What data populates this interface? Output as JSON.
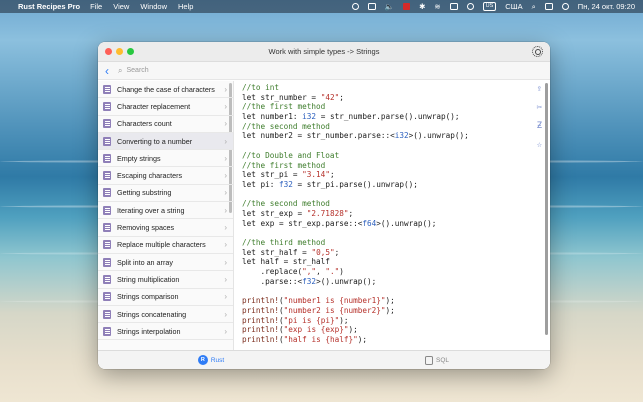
{
  "menubar": {
    "app_name": "Rust Recipes Pro",
    "menus": [
      "File",
      "View",
      "Window",
      "Help"
    ],
    "input_source": "США",
    "datetime": "Пн, 24 окт.  09:20"
  },
  "window": {
    "title": "Work with simple types -> Strings",
    "search_placeholder": "Search"
  },
  "sidebar": {
    "items": [
      {
        "label": "Change the case of characters",
        "active": false
      },
      {
        "label": "Character replacement",
        "active": false
      },
      {
        "label": "Characters count",
        "active": false
      },
      {
        "label": "Converting to a number",
        "active": true
      },
      {
        "label": "Empty strings",
        "active": false
      },
      {
        "label": "Escaping characters",
        "active": false
      },
      {
        "label": "Getting substring",
        "active": false
      },
      {
        "label": "Iterating over a string",
        "active": false
      },
      {
        "label": "Removing spaces",
        "active": false
      },
      {
        "label": "Replace multiple characters",
        "active": false
      },
      {
        "label": "Split into an array",
        "active": false
      },
      {
        "label": "String multiplication",
        "active": false
      },
      {
        "label": "Strings comparison",
        "active": false
      },
      {
        "label": "Strings concatenating",
        "active": false
      },
      {
        "label": "Strings interpolation",
        "active": false
      }
    ]
  },
  "code_lines": [
    "//to int",
    "let str_number = \"42\";",
    "//the first method",
    "let number1: i32 = str_number.parse().unwrap();",
    "//the second method",
    "let number2 = str_number.parse::<i32>().unwrap();",
    "",
    "//to Double and Float",
    "//the first method",
    "let str_pi = \"3.14\";",
    "let pi: f32 = str_pi.parse().unwrap();",
    "",
    "//the second method",
    "let str_exp = \"2.71828\";",
    "let exp = str_exp.parse::<f64>().unwrap();",
    "",
    "//the third method",
    "let str_half = \"0,5\";",
    "let half = str_half",
    "    .replace(\",\", \".\")",
    "    .parse::<f32>().unwrap();",
    "",
    "println!(\"number1 is {number1}\");",
    "println!(\"number2 is {number2}\");",
    "println!(\"pi is {pi}\");",
    "println!(\"exp is {exp}\");",
    "println!(\"half is {half}\");"
  ],
  "tabs": [
    {
      "label": "Rust",
      "active": true
    },
    {
      "label": "SQL",
      "active": false
    }
  ],
  "colors": {
    "accent": "#2f7cf6",
    "comment": "#3e7d2c",
    "type": "#2a5ebd",
    "string": "#b5302a"
  }
}
